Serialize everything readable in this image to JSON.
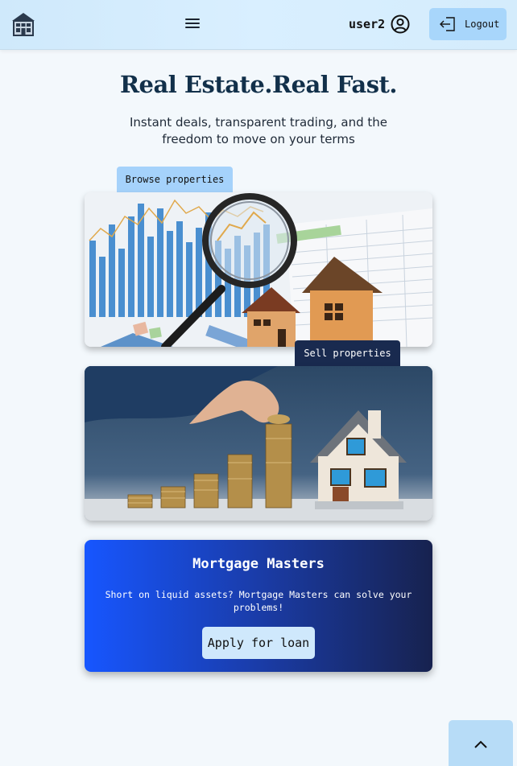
{
  "header": {
    "logo_icon": "house-logo-icon",
    "menu_icon": "hamburger-icon",
    "username": "user2",
    "user_icon": "user-circle-icon",
    "logout_label": "Logout",
    "logout_icon": "logout-icon"
  },
  "hero": {
    "title": "Real Estate.Real Fast.",
    "subtitle": "Instant deals, transparent trading, and the freedom to move on your terms"
  },
  "cards": {
    "browse_label": "Browse properties",
    "sell_label": "Sell properties"
  },
  "mortgage": {
    "title": "Mortgage Masters",
    "text": "Short on liquid assets? Mortgage Masters can solve your problems!",
    "button_label": "Apply for loan"
  },
  "scroll_top_icon": "chevron-up-icon",
  "colors": {
    "header_bg": "#d4ecfc",
    "logout_bg": "#a8d6fb",
    "browse_tab": "#a5d2fb",
    "sell_tab": "#192a4f",
    "mortgage_start": "#1756ff",
    "mortgage_end": "#17224f"
  }
}
